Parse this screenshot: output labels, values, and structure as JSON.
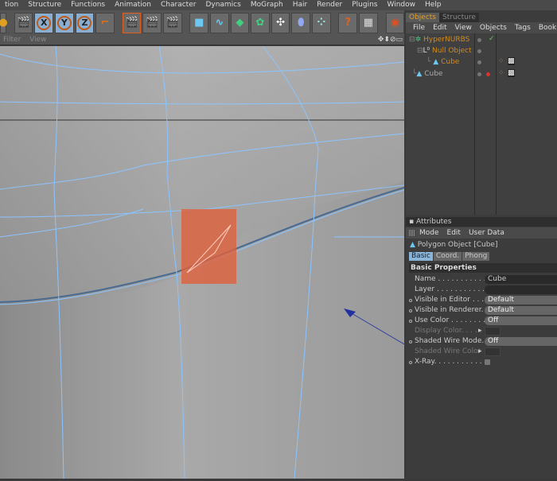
{
  "menu": [
    "tion",
    "Structure",
    "Functions",
    "Animation",
    "Character",
    "Dynamics",
    "MoGraph",
    "Hair",
    "Render",
    "Plugins",
    "Window",
    "Help"
  ],
  "viewport": {
    "menu": [
      "Filter",
      "View"
    ],
    "nav_icons": "✥⬍⊘▭"
  },
  "objects_panel": {
    "tabs": [
      "Objects",
      "Structure"
    ],
    "menu": [
      "File",
      "Edit",
      "View",
      "Objects",
      "Tags",
      "Book"
    ],
    "items": [
      {
        "name": "HyperNURBS",
        "icon": "hypernurbs-icon"
      },
      {
        "name": "Null Object",
        "icon": "null-icon"
      },
      {
        "name": "Cube",
        "icon": "polygon-icon"
      },
      {
        "name": "Cube",
        "icon": "polygon-icon"
      }
    ]
  },
  "attributes": {
    "title": "Attributes",
    "menu": [
      "Mode",
      "Edit",
      "User Data"
    ],
    "object_title": "Polygon Object [Cube]",
    "tabs": [
      "Basic",
      "Coord.",
      "Phong"
    ],
    "section": "Basic Properties",
    "rows": [
      {
        "label": "Name . . . . . . . . . . . .",
        "value": "Cube"
      },
      {
        "label": "Layer . . . . . . . . . . . .",
        "value": ""
      },
      {
        "label": "Visible in Editor . . . . .",
        "value": "Default"
      },
      {
        "label": "Visible in Renderer. .",
        "value": "Default"
      },
      {
        "label": "Use Color . . . . . . . . .",
        "value": "Off"
      },
      {
        "label": "Display Color. . . . .",
        "value": ""
      },
      {
        "label": "Shaded Wire Mode. .",
        "value": "Off"
      },
      {
        "label": "Shaded Wire Color",
        "value": ""
      },
      {
        "label": "X-Ray. . . . . . . . . . . .",
        "value": ""
      }
    ]
  },
  "colors": {
    "accent": "#d08a20",
    "wire": "#7ab8ff",
    "selection": "#e0603c"
  }
}
